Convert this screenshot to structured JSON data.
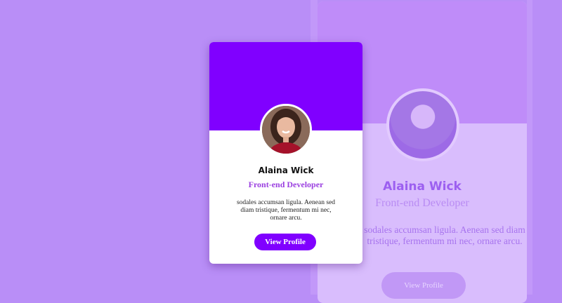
{
  "profile": {
    "name": "Alaina Wick",
    "role": "Front-end Developer",
    "description": "sodales accumsan ligula. Aenean sed diam tristique, fermentum mi nec, ornare arcu.",
    "button_label": "View Profile",
    "avatar_icon": "profile-photo"
  },
  "ghost": {
    "name": "Alaina Wick",
    "role": "Front-end Developer",
    "description": "sodales accumsan ligula. Aenean sed diam tristique, fermentum mi nec, ornare arcu.",
    "button_label": "View Profile"
  },
  "colors": {
    "background": "#b98ef7",
    "accent": "#8000ff",
    "role_text": "#9b40e0",
    "card": "#ffffff"
  }
}
